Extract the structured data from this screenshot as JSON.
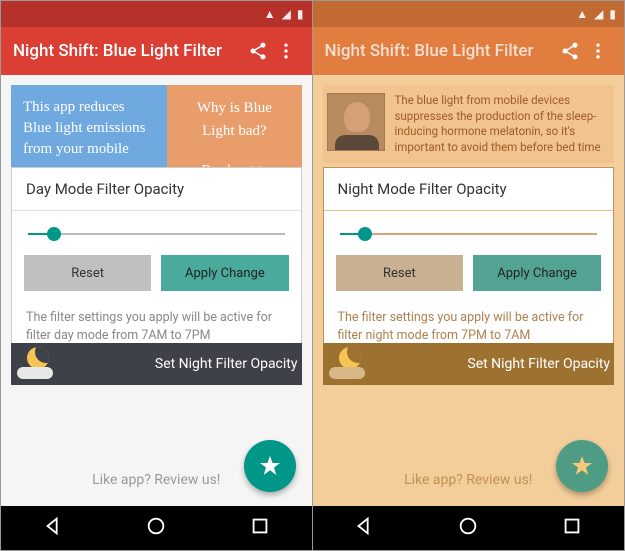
{
  "left": {
    "status_time": "",
    "app_title": "Night Shift: Blue Light Filter",
    "info_blue": "This app reduces Blue light emissions from your mobile",
    "info_orange_q": "Why is Blue Light bad?",
    "info_orange_read": "Read on >>",
    "card_title": "Day Mode Filter Opacity",
    "slider_percent": 10,
    "reset_label": "Reset",
    "apply_label": "Apply Change",
    "card_footer": "The filter settings you apply will be active for filter day mode from 7AM to 7PM",
    "night_bar": "Set Night Filter Opacity",
    "footer": "Like app? Review us!"
  },
  "right": {
    "app_title": "Night Shift: Blue Light Filter",
    "testimonial": "The blue light from mobile devices suppresses the production of the sleep-inducing hormone melatonin, so it's important to avoid them before bed time",
    "card_title": "Night Mode Filter Opacity",
    "slider_percent": 10,
    "reset_label": "Reset",
    "apply_label": "Apply Change",
    "card_footer": "The filter settings you apply will be active for filter night mode from 7PM to 7AM",
    "night_bar": "Set Night Filter Opacity",
    "footer": "Like app? Review us!"
  }
}
